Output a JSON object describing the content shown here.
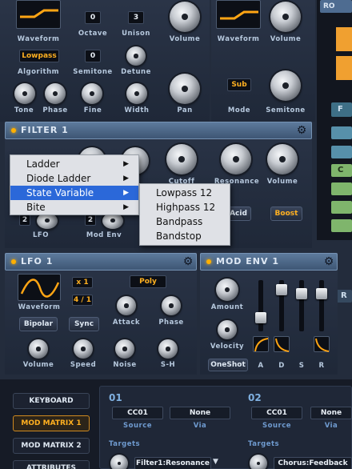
{
  "osc1": {
    "waveform": "Waveform",
    "octave_label": "Octave",
    "octave_val": "0",
    "unison_label": "Unison",
    "unison_val": "3",
    "volume": "Volume",
    "algorithm_val": "Lowpass",
    "algorithm": "Algorithm",
    "semitone_val": "0",
    "semitone": "Semitone",
    "detune": "Detune",
    "tone": "Tone",
    "phase": "Phase",
    "fine": "Fine",
    "width": "Width",
    "pan": "Pan"
  },
  "osc2": {
    "waveform": "Waveform",
    "volume": "Volume",
    "mode_val": "Sub",
    "mode": "Mode",
    "semitone": "Semitone",
    "top_right": "RO"
  },
  "filter": {
    "title": "FILTER 1",
    "cutoff": "Cutoff",
    "resonance": "Resonance",
    "volume": "Volume",
    "acid": "Acid",
    "boost": "Boost",
    "lfo": "LFO",
    "lfo_val": "2",
    "modenv": "Mod Env",
    "modenv_val": "2"
  },
  "menu": {
    "items": [
      "Ladder",
      "Diode Ladder",
      "State Variable",
      "Bite"
    ],
    "sub": [
      "Lowpass 12",
      "Highpass 12",
      "Bandpass",
      "Bandstop"
    ]
  },
  "lfo": {
    "title": "LFO 1",
    "waveform": "Waveform",
    "mult": "x 1",
    "rate": "4 / 1",
    "poly": "Poly",
    "bipolar": "Bipolar",
    "sync": "Sync",
    "attack": "Attack",
    "phase": "Phase",
    "volume": "Volume",
    "speed": "Speed",
    "noise": "Noise",
    "sh": "S-H"
  },
  "env": {
    "title": "MOD ENV 1",
    "amount": "Amount",
    "velocity": "Velocity",
    "oneshot": "OneShot",
    "a": "A",
    "d": "D",
    "s": "S",
    "r": "R",
    "levels": {
      "a": 0.2,
      "d": 0.9,
      "s": 0.8,
      "r": 0.8
    }
  },
  "side": {
    "keyboard": "KEYBOARD",
    "mm1": "MOD MATRIX 1",
    "mm2": "MOD MATRIX 2",
    "attributes": "ATTRIBUTES"
  },
  "matrix": {
    "slot1": {
      "num": "01",
      "src": "CC01",
      "via": "None",
      "src_label": "Source",
      "via_label": "Via",
      "targets": "Targets",
      "target_val": "Filter1:Resonance"
    },
    "slot2": {
      "num": "02",
      "src": "CC01",
      "via": "None",
      "src_label": "Source",
      "via_label": "Via",
      "targets": "Targets",
      "target_val": "Chorus:Feedback"
    }
  },
  "right": {
    "f": "F",
    "c": "C",
    "r": "R"
  }
}
